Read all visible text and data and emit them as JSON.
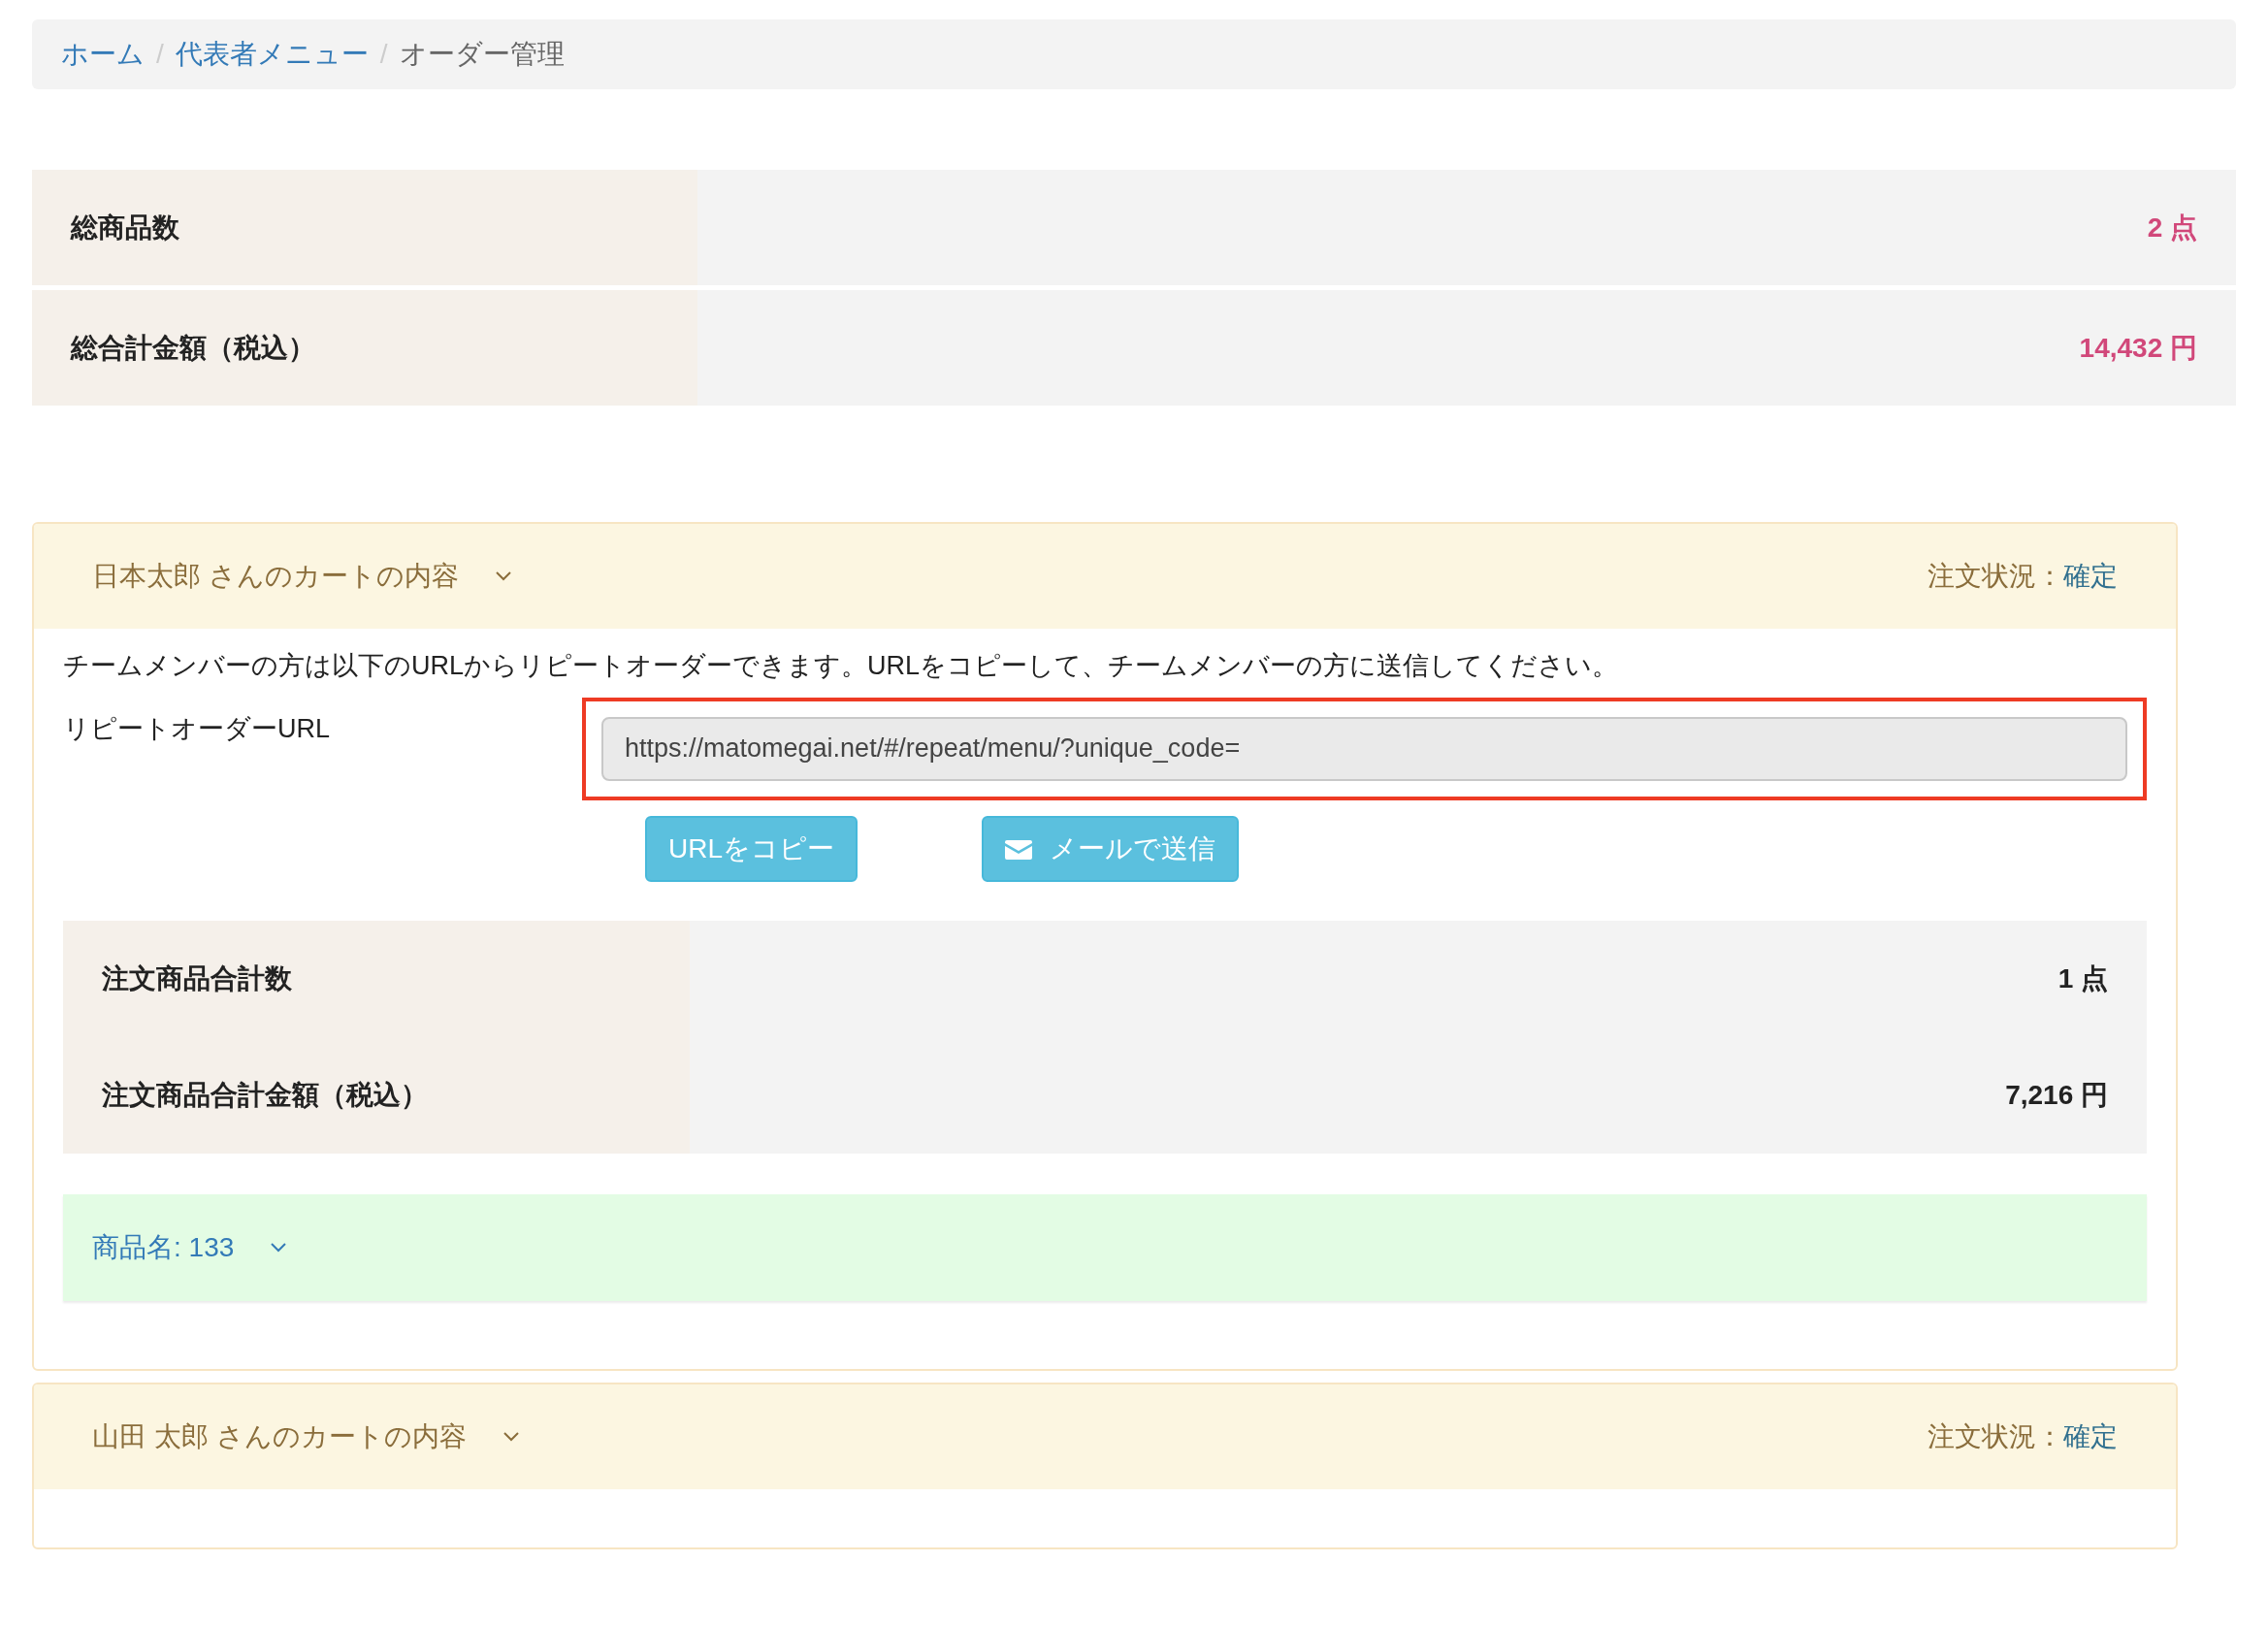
{
  "breadcrumb_separator": "/",
  "breadcrumb": [
    {
      "label": "ホーム",
      "link": true
    },
    {
      "label": "代表者メニュー",
      "link": true
    },
    {
      "label": "オーダー管理",
      "link": false
    }
  ],
  "summary": [
    {
      "label": "総商品数",
      "value": "2 点"
    },
    {
      "label": "総合計金額（税込）",
      "value": "14,432 円"
    }
  ],
  "carts": [
    {
      "title": "日本太郎 さんのカートの内容",
      "status_label": "注文状況：",
      "status": "確定",
      "expanded": true,
      "notice": "チームメンバーの方は以下のURLからリピートオーダーできます。URLをコピーして、チームメンバーの方に送信してください。",
      "url_label": "リピートオーダーURL",
      "url_value": "https://matomegai.net/#/repeat/menu/?unique_code=",
      "url_highlighted": true,
      "buttons": [
        {
          "label": "URLをコピー",
          "kind": "copy"
        },
        {
          "label": "メールで送信",
          "kind": "mail"
        }
      ],
      "totals": [
        {
          "label": "注文商品合計数",
          "value": "1 点"
        },
        {
          "label": "注文商品合計金額（税込）",
          "value": "7,216 円"
        }
      ],
      "items": [
        {
          "title": "商品名: 133"
        }
      ]
    },
    {
      "title": "山田 太郎 さんのカートの内容",
      "status_label": "注文状況：",
      "status": "確定",
      "expanded": false
    }
  ]
}
